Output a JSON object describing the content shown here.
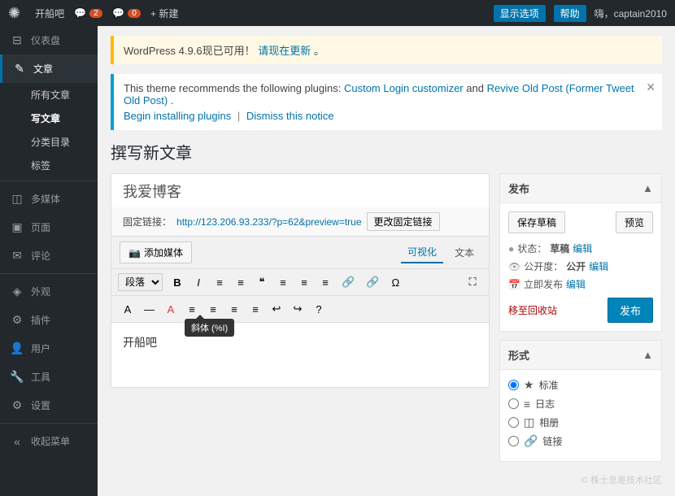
{
  "adminbar": {
    "logo": "✺",
    "site_name": "开船吧",
    "comments_count": "2",
    "chat_count": "0",
    "new_label": "+ 新建",
    "display_options": "显示选项",
    "help": "帮助",
    "user_greeting": "嗨，captain2010"
  },
  "sidebar": {
    "items": [
      {
        "id": "dashboard",
        "icon": "⊟",
        "label": "仪表盘"
      },
      {
        "id": "posts",
        "icon": "✎",
        "label": "文章",
        "active": true,
        "expanded": true
      },
      {
        "id": "media",
        "icon": "◫",
        "label": "多媒体"
      },
      {
        "id": "pages",
        "icon": "▣",
        "label": "页面"
      },
      {
        "id": "comments",
        "icon": "✉",
        "label": "评论"
      },
      {
        "id": "appearance",
        "icon": "◈",
        "label": "外观"
      },
      {
        "id": "plugins",
        "icon": "⚙",
        "label": "插件"
      },
      {
        "id": "users",
        "icon": "👤",
        "label": "用户"
      },
      {
        "id": "tools",
        "icon": "🔧",
        "label": "工具"
      },
      {
        "id": "settings",
        "icon": "⚙",
        "label": "设置"
      },
      {
        "id": "collapse",
        "icon": "«",
        "label": "收起菜单"
      }
    ],
    "post_submenu": [
      {
        "id": "all-posts",
        "label": "所有文章"
      },
      {
        "id": "write-post",
        "label": "写文章",
        "active": true
      },
      {
        "id": "categories",
        "label": "分类目录"
      },
      {
        "id": "tags",
        "label": "标签"
      }
    ]
  },
  "update_notice": {
    "text_before": "WordPress 4.9.6现已可用！",
    "link_text": "请现在更新",
    "text_after": "。"
  },
  "plugin_notice": {
    "text_before": "This theme recommends the following plugins: ",
    "plugin1": "Custom Login customizer",
    "and_text": " and ",
    "plugin2": "Revive Old Post (Former Tweet Old Post)",
    "text_after": ".",
    "install_link": "Begin installing plugins",
    "dismiss_link": "Dismiss this notice",
    "separator": "|"
  },
  "page": {
    "title": "撰写新文章"
  },
  "editor": {
    "title_placeholder": "我爱博客",
    "permalink_label": "固定链接：",
    "permalink_url": "http://123.206.93.233/?p=62&preview=true",
    "permalink_btn": "更改固定链接",
    "add_media": "添加媒体",
    "view_visual": "可视化",
    "view_text": "文本",
    "format_select": "段落",
    "toolbar_buttons": [
      "B",
      "I",
      "≡",
      "≡",
      "❝",
      "≡",
      "≡",
      "≡",
      "🔗",
      "🔗",
      "Ω"
    ],
    "toolbar2_buttons": [
      "A",
      "—",
      "A",
      "≡",
      "≡",
      "≡",
      "≡",
      "↩",
      "↪",
      "?"
    ],
    "italic_tooltip": "斜体 (%I)",
    "content": "开船吧",
    "expand_icon": "⛶"
  },
  "publish_box": {
    "title": "发布",
    "save_draft": "保存草稿",
    "preview": "预览",
    "status_label": "状态：",
    "status_value": "草稿",
    "status_link": "编辑",
    "visibility_label": "公开度：",
    "visibility_value": "公开",
    "visibility_link": "编辑",
    "date_label": "立即发布",
    "date_link": "编辑",
    "trash_link": "移至回收站",
    "publish_btn": "发布"
  },
  "format_box": {
    "title": "形式",
    "formats": [
      {
        "id": "standard",
        "icon": "★",
        "label": "标准",
        "checked": true
      },
      {
        "id": "aside",
        "icon": "≡",
        "label": "日志",
        "checked": false
      },
      {
        "id": "gallery",
        "icon": "◫",
        "label": "相册",
        "checked": false
      },
      {
        "id": "link",
        "icon": "🔗",
        "label": "链接",
        "checked": false
      }
    ]
  },
  "watermark": "© 株士息差技术社区"
}
